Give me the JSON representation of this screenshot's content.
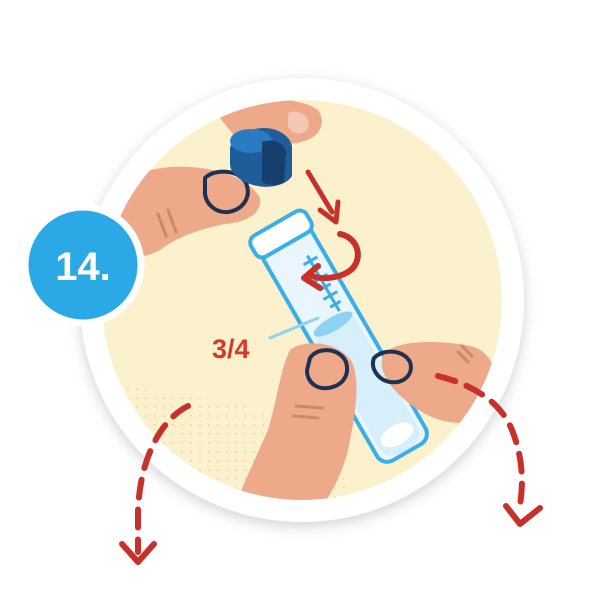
{
  "step_badge": {
    "number": "14."
  },
  "fill_level": {
    "label": "3/4"
  },
  "colors": {
    "background_circle": "#fbf1cc",
    "frame": "#ffffff",
    "badge": "#2aa9e6",
    "skin": "#eea88a",
    "skin_crease": "#c98b63",
    "outline": "#1d3150",
    "cap": "#1f5c9a",
    "tube_stroke": "#3aaee8",
    "liquid": "#8cd2f3",
    "arrow": "#c8312b"
  },
  "icons": {
    "cap": "cap-icon",
    "tube": "test-tube-icon",
    "rotate": "rotate-arrow-icon",
    "insert": "down-arrow-icon"
  }
}
